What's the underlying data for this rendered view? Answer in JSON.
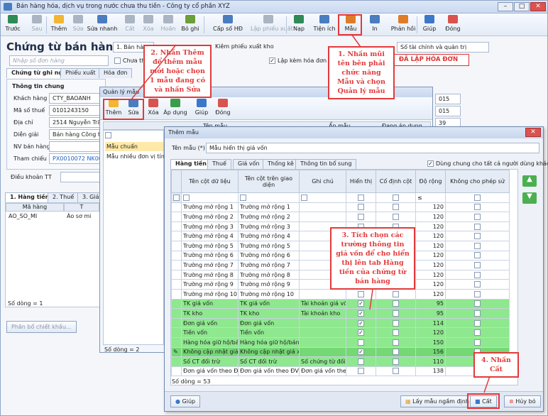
{
  "window": {
    "title": "Bán hàng hóa, dịch vụ trong nước chưa thu tiền - Công ty cổ phần XYZ"
  },
  "toolbar": {
    "items": [
      {
        "label": "Trước",
        "icon": "prev-arrow-icon",
        "color": "#2e8b57"
      },
      {
        "label": "Sau",
        "icon": "next-arrow-icon",
        "color": "#aab4c2"
      },
      {
        "label": "Thêm",
        "icon": "add-doc-icon",
        "color": "#f2b632"
      },
      {
        "label": "Sửa",
        "icon": "edit-icon",
        "color": "#aab4c2"
      },
      {
        "label": "Sửa nhanh",
        "icon": "quick-edit-icon",
        "color": "#4a7dc0"
      },
      {
        "label": "Cất",
        "icon": "save-icon",
        "color": "#aab4c2"
      },
      {
        "label": "Xóa",
        "icon": "delete-icon",
        "color": "#aab4c2"
      },
      {
        "label": "Hoãn",
        "icon": "undo-icon",
        "color": "#aab4c2"
      },
      {
        "label": "Bỏ ghi",
        "icon": "unpost-icon",
        "color": "#6a9f3a"
      },
      {
        "label": "Cấp số HĐ",
        "icon": "invoice-number-icon",
        "color": "#4a7dc0"
      },
      {
        "label": "Lập phiếu xuất",
        "icon": "export-slip-icon",
        "color": "#aab4c2"
      },
      {
        "label": "Nạp",
        "icon": "reload-icon",
        "color": "#2e8b57"
      },
      {
        "label": "Tiện ích",
        "icon": "utilities-icon",
        "color": "#4a7dc0"
      },
      {
        "label": "Mẫu",
        "icon": "template-icon",
        "color": "#e07b2a"
      },
      {
        "label": "In",
        "icon": "print-icon",
        "color": "#4a7dc0"
      },
      {
        "label": "Phản hồi",
        "icon": "feedback-icon",
        "color": "#e07b2a"
      },
      {
        "label": "Giúp",
        "icon": "help-icon",
        "color": "#3b78c9"
      },
      {
        "label": "Đóng",
        "icon": "close-icon",
        "color": "#d9534f"
      }
    ]
  },
  "doc": {
    "title": "Chứng từ bán hàng",
    "doc_no_placeholder": "Nhập số đơn hàng",
    "type_select": "1. Bán hàng",
    "kiem_phieu": "Kiêm phiếu xuất kho",
    "chua_thu": "Chưa thu",
    "lap_kem_hd": "Lập kèm hóa đơn",
    "finance_label": "Số tài chính và quản trị",
    "red_button": "ĐÃ LẬP HÓA ĐƠN",
    "tabs": [
      "Chứng từ ghi nợ",
      "Phiếu xuất",
      "Hóa đơn"
    ],
    "section": "Thông tin chung",
    "fields": [
      {
        "label": "Khách hàng",
        "value": "CTY_BAOANH"
      },
      {
        "label": "Mã số thuế",
        "value": "0101243150"
      },
      {
        "label": "Địa chỉ",
        "value": "2514 Nguyễn Trãi, Th"
      },
      {
        "label": "Diễn giải",
        "value": "Bán hàng Công ty TN"
      },
      {
        "label": "NV bán hàng",
        "value": ""
      },
      {
        "label": "Tham chiếu",
        "value": "PX0010072  NK0006"
      }
    ],
    "dieu_khoan": "Điều khoản TT",
    "right_values": [
      "015",
      "015",
      "39"
    ],
    "line_tabs": [
      "1. Hàng tiền",
      "2. Thuế",
      "3. Giá v"
    ],
    "line_headers": [
      "Mã hàng",
      "T"
    ],
    "line_row": [
      "AO_SO_MI",
      "Áo sơ mi"
    ],
    "line_count": "Số dòng = 1",
    "phan_bo": "Phân bổ chiết khấu..."
  },
  "ql": {
    "title": "Quản lý mẫu",
    "toolbar": [
      {
        "label": "Thêm",
        "icon": "add-doc-icon"
      },
      {
        "label": "Sửa",
        "icon": "edit-icon"
      },
      {
        "label": "Xóa",
        "icon": "delete-icon"
      },
      {
        "label": "Áp dụng",
        "icon": "apply-icon"
      },
      {
        "label": "Giúp",
        "icon": "help-icon"
      },
      {
        "label": "Đóng",
        "icon": "close-icon"
      }
    ],
    "cols": [
      "Tên mẫu",
      "Ẩn mẫu",
      "Đang áp dụng"
    ],
    "rows": [
      "Mẫu chuẩn",
      "Mẫu nhiều đơn vị tính"
    ],
    "count": "Số dòng = 2"
  },
  "tm": {
    "title": "Thêm mẫu",
    "name_label": "Tên mẫu (*)",
    "name_value": "Mẫu hiển thị giá vốn",
    "share_label": "Dùng chung cho tất cả người dùng khác",
    "tabs": [
      "Hàng tiền",
      "Thuế",
      "Giá vốn",
      "Thống kê",
      "Thông tin bổ sung"
    ],
    "headers": [
      "Tên cột dữ liệu",
      "Tên cột trên giao diện",
      "Ghi chú",
      "Hiển thị",
      "Cố định cột",
      "Độ rộng",
      "Không cho phép sử"
    ],
    "filter_op": "≤",
    "rows": [
      {
        "name": "Trường mở rộng 1",
        "ui": "Trường mở rộng 1",
        "note": "",
        "show": false,
        "fix": false,
        "width": "120",
        "green": false
      },
      {
        "name": "Trường mở rộng 2",
        "ui": "Trường mở rộng 2",
        "note": "",
        "show": false,
        "fix": false,
        "width": "120",
        "green": false
      },
      {
        "name": "Trường mở rộng 3",
        "ui": "Trường mở rộng 3",
        "note": "",
        "show": false,
        "fix": false,
        "width": "120",
        "green": false
      },
      {
        "name": "Trường mở rộng 4",
        "ui": "Trường mở rộng 4",
        "note": "",
        "show": false,
        "fix": false,
        "width": "120",
        "green": false
      },
      {
        "name": "Trường mở rộng 5",
        "ui": "Trường mở rộng 5",
        "note": "",
        "show": false,
        "fix": false,
        "width": "120",
        "green": false
      },
      {
        "name": "Trường mở rộng 6",
        "ui": "Trường mở rộng 6",
        "note": "",
        "show": false,
        "fix": false,
        "width": "120",
        "green": false
      },
      {
        "name": "Trường mở rộng 7",
        "ui": "Trường mở rộng 7",
        "note": "",
        "show": false,
        "fix": false,
        "width": "120",
        "green": false
      },
      {
        "name": "Trường mở rộng 8",
        "ui": "Trường mở rộng 8",
        "note": "",
        "show": false,
        "fix": false,
        "width": "120",
        "green": false
      },
      {
        "name": "Trường mở rộng 9",
        "ui": "Trường mở rộng 9",
        "note": "",
        "show": false,
        "fix": false,
        "width": "120",
        "green": false
      },
      {
        "name": "Trường mở rộng 10",
        "ui": "Trường mở rộng 10",
        "note": "",
        "show": false,
        "fix": false,
        "width": "120",
        "green": false
      },
      {
        "name": "TK giá vốn",
        "ui": "TK giá vốn",
        "note": "Tài khoản giá vốn",
        "show": true,
        "fix": false,
        "width": "95",
        "green": true
      },
      {
        "name": "TK kho",
        "ui": "TK kho",
        "note": "Tài khoản kho",
        "show": true,
        "fix": false,
        "width": "95",
        "green": true
      },
      {
        "name": "Đơn giá vốn",
        "ui": "Đơn giá vốn",
        "note": "",
        "show": true,
        "fix": false,
        "width": "114",
        "green": true
      },
      {
        "name": "Tiền vốn",
        "ui": "Tiền vốn",
        "note": "",
        "show": true,
        "fix": false,
        "width": "120",
        "green": true
      },
      {
        "name": "Hàng hóa giữ hộ/bán h",
        "ui": "Hàng hóa giữ hộ/bán h",
        "note": "",
        "show": false,
        "fix": false,
        "width": "150",
        "green": true
      },
      {
        "name": "Không cập nhật giá x",
        "ui": "Không cập nhật giá xu",
        "note": "",
        "show": true,
        "fix": false,
        "width": "156",
        "green": true,
        "selected": true
      },
      {
        "name": "Số CT đối trừ",
        "ui": "Số CT đối trừ",
        "note": "Số chứng từ đối tr",
        "show": false,
        "fix": false,
        "width": "110",
        "green": true
      },
      {
        "name": "Đơn giá vốn theo ĐV",
        "ui": "Đơn giá vốn theo ĐVC",
        "note": "Đơn giá vốn theo",
        "show": false,
        "fix": false,
        "width": "138",
        "green": false
      }
    ],
    "count": "Số dòng = 53",
    "btn_help": "Giúp",
    "btn_default": "Lấy mẫu ngầm định",
    "btn_save": "Cất",
    "btn_cancel": "Hủy bỏ"
  },
  "callouts": {
    "c1": "1. Nhấn mũi tên bên phải chức năng Mẫu và chọn Quản lý mẫu",
    "c2": "2. Nhấn Thêm để thêm mẫu mới hoặc chọn 1 mẫu đang có và nhấn Sửa",
    "c3": "3. Tích chọn các trường thông tin giá vốn để cho hiển thị lên tab Hàng tiền của chứng từ bán hàng",
    "c4": "4. Nhấn Cất"
  }
}
